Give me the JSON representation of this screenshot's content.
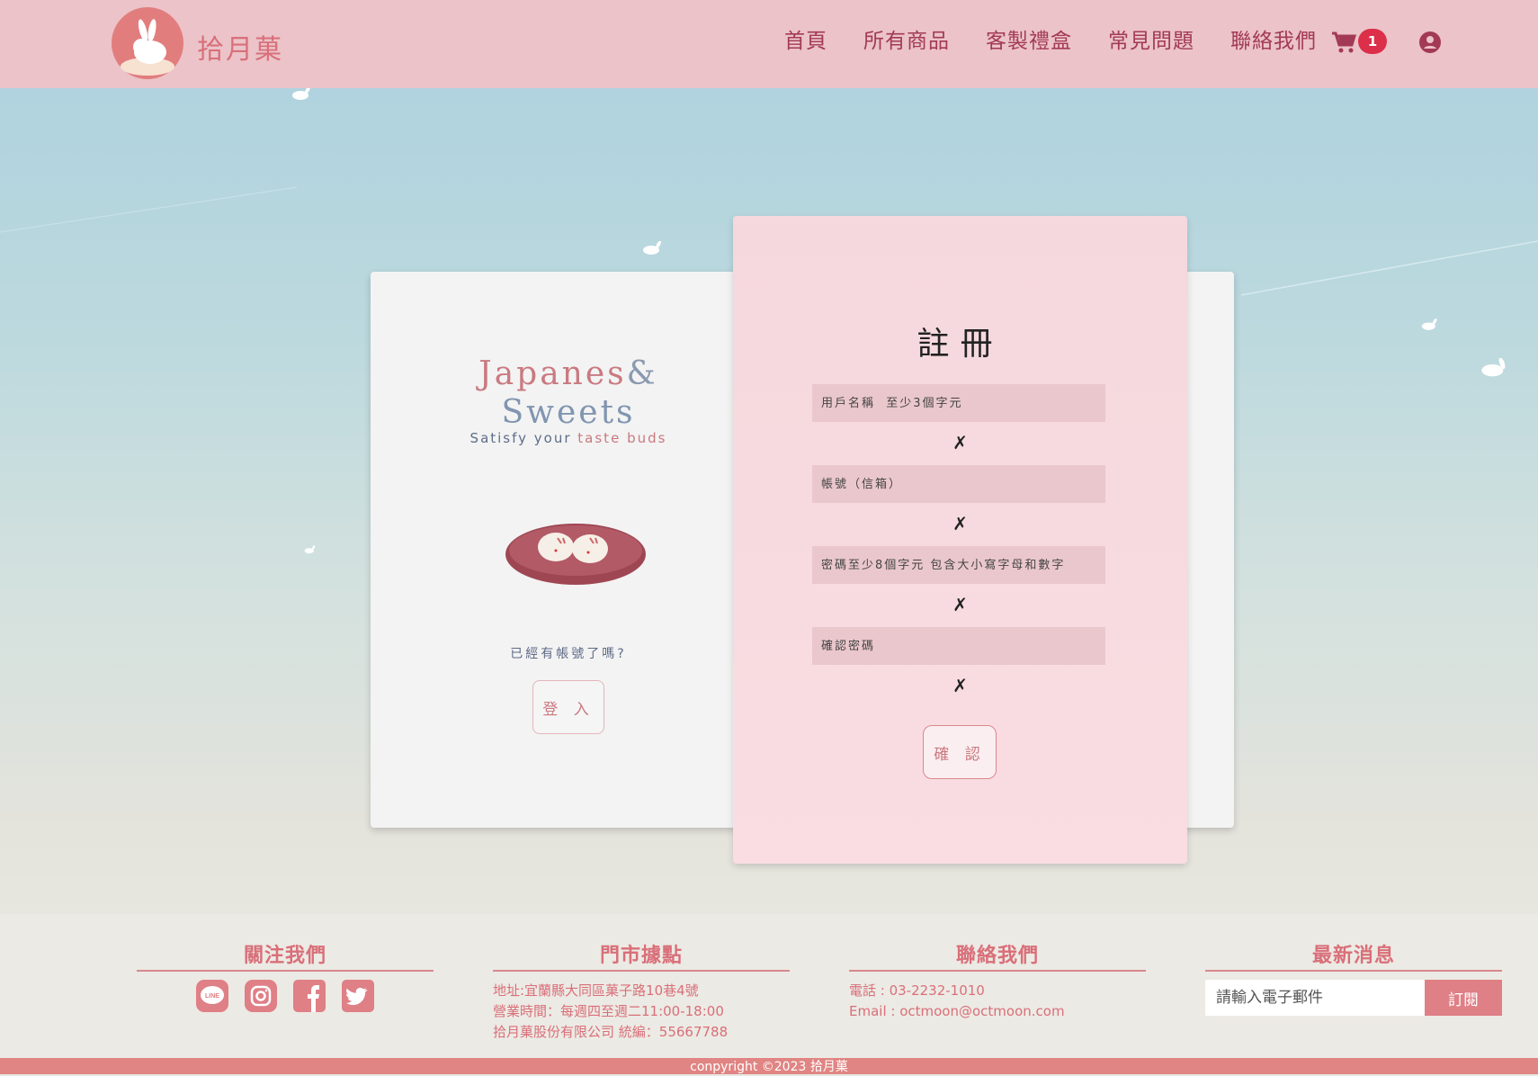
{
  "header": {
    "logo_text": "拾月菓",
    "nav": [
      "首頁",
      "所有商品",
      "客製禮盒",
      "常見問題",
      "聯絡我們"
    ],
    "cart_count": "1"
  },
  "brand": {
    "line1_a": "Japanes",
    "line1_b": "&",
    "line2": "Sweets",
    "tagline_a": "Satisfy your",
    "tagline_b": "taste buds"
  },
  "login_panel": {
    "question": "已經有帳號了嗎?",
    "login_label": "登 入"
  },
  "register": {
    "title": "註冊",
    "username_placeholder": "用戶名稱  至少3個字元",
    "account_placeholder": "帳號（信箱）",
    "password_placeholder": "密碼至少8個字元 包含大小寫字母和數字",
    "confirm_placeholder": "確認密碼",
    "error_mark": "✗",
    "confirm_label": "確 認"
  },
  "footer": {
    "follow_title": "關注我們",
    "social": [
      "line-icon",
      "instagram-icon",
      "facebook-icon",
      "twitter-icon"
    ],
    "store_title": "門市據點",
    "store_lines": [
      "地址:宜蘭縣大同區菓子路10巷4號",
      "營業時間：每週四至週二11:00-18:00",
      "拾月菓股份有限公司 統編：55667788"
    ],
    "contact_title": "聯絡我們",
    "contact_lines": [
      "電話 : 03-2232-1010",
      "Email : octmoon@octmoon.com"
    ],
    "news_title": "最新消息",
    "email_placeholder": "請輸入電子郵件",
    "subscribe_label": "訂閱"
  },
  "copyright": "conpyright ©2023 拾月菓",
  "colors": {
    "header_bg": "#ebc3c9",
    "accent": "#d96f79",
    "nav_text": "#a33a55",
    "badge": "#dc2f4a",
    "register_card": "#f8dbe0",
    "copyright_bar": "#e08583"
  }
}
